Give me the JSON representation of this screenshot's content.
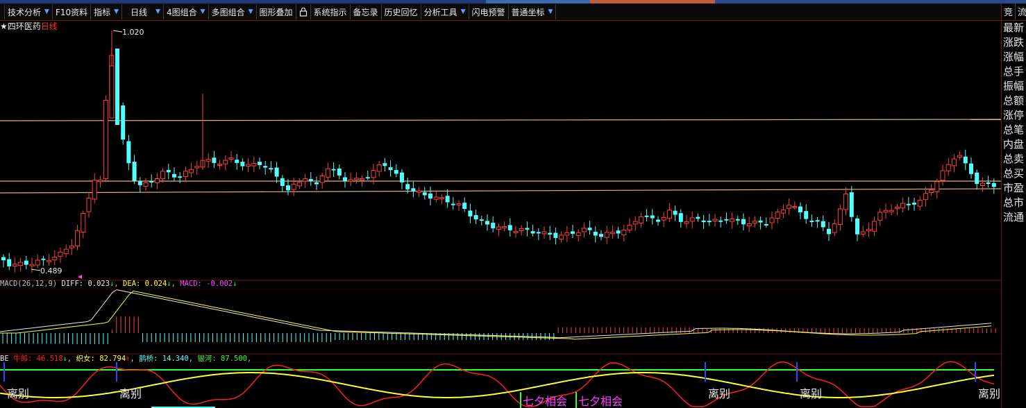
{
  "toolbar": {
    "items": [
      {
        "label": "技术分析",
        "dropdown": true
      },
      {
        "label": "F10资料",
        "dropdown": false
      },
      {
        "label": "指标",
        "dropdown": true
      },
      {
        "label": "日线",
        "dropdown": true
      },
      {
        "label": "4图组合",
        "dropdown": true
      },
      {
        "label": "多图组合",
        "dropdown": true
      },
      {
        "label": "图形叠加",
        "dropdown": false
      },
      {
        "label": "系统指示",
        "dropdown": false
      },
      {
        "label": "备忘录",
        "dropdown": false
      },
      {
        "label": "历史回忆",
        "dropdown": false
      },
      {
        "label": "分析工具",
        "dropdown": true
      },
      {
        "label": "闪电预警",
        "dropdown": false
      },
      {
        "label": "普通坐标",
        "dropdown": true
      }
    ],
    "lock_icon": "lock-icon"
  },
  "right_panel": {
    "tabs": [
      "竞",
      "流"
    ],
    "labels": [
      "最新",
      "涨跌",
      "涨幅",
      "总手",
      "振幅",
      "总额",
      "涨停",
      "总笔",
      "内盘",
      "总卖",
      "总买",
      "市盈",
      "总市",
      "流通"
    ]
  },
  "chart_header": {
    "star": "★",
    "name": "四环医药",
    "period": "日线"
  },
  "price_pane": {
    "high_label": "1.020",
    "low_label": "0.489"
  },
  "macd_pane": {
    "name": "MACD(26,12,9)",
    "diff_label": "DIFF:",
    "diff_value": "0.023",
    "diff_arrow": "↓",
    "dea_label": "DEA:",
    "dea_value": "0.024",
    "dea_arrow": "↓",
    "macd_label": "MACD:",
    "macd_value": "-0.002",
    "macd_arrow": "↓"
  },
  "qixi_pane": {
    "prefix": "BE",
    "niulang_label": "牛郎:",
    "niulang_value": "46.518",
    "niulang_arrow": "↓",
    "zhinv_label": "织女:",
    "zhinv_value": "82.794",
    "zhinv_arrow": "↑",
    "queqiao_label": "鹊桥:",
    "queqiao_value": "14.340,",
    "yinhe_label": "银河:",
    "yinhe_value": "87.500,",
    "annotation_part": "离别",
    "annotation_meet": "七夕相会"
  },
  "colors": {
    "up": "#ff4040",
    "down": "#54ffff",
    "border": "#7a1010",
    "hline": "#e8b070",
    "white": "#e8e8e8",
    "yellow": "#ffff30",
    "magenta": "#ff40ff",
    "green": "#30ff30",
    "red": "#ff2020"
  }
}
